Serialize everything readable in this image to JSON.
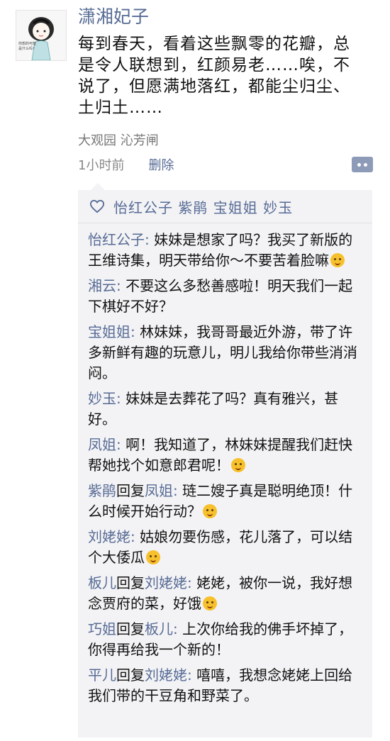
{
  "post": {
    "author": "潇湘妃子",
    "text": "每到春天，看着这些飘零的花瓣，总是令人联想到，红颜易老……唉，不说了，但愿满地落红，都能尘归尘、土归土……",
    "location": "大观园 沁芳闸",
    "time": "1小时前",
    "delete_label": "删除",
    "avatar_caption": "你想的可能是什么吗?"
  },
  "likes": {
    "names": "怡红公子 紫鹃 宝姐姐 妙玉"
  },
  "comments": [
    {
      "name": "怡红公子",
      "sep": ": ",
      "text": "妹妹是想家了吗？我买了新版的王维诗集，明天带给你～不要苦着脸嘛",
      "emoji": "kiss-emoji"
    },
    {
      "name": "湘云",
      "sep": ": ",
      "text": "不要这么多愁善感啦！明天我们一起下棋好不好？"
    },
    {
      "name": "宝姐姐",
      "sep": ": ",
      "text": "林妹妹，我哥哥最近外游，带了许多新鲜有趣的玩意儿，明儿我给你带些消消闷。"
    },
    {
      "name": "妙玉",
      "sep": ": ",
      "text": "妹妹是去葬花了吗？真有雅兴，甚好。"
    },
    {
      "name": "凤姐",
      "sep": ": ",
      "text": "啊！我知道了，林妹妹提醒我们赶快帮她找个如意郎君呢！",
      "emoji": "tongue-emoji"
    },
    {
      "name": "紫鹃",
      "reply_word": "回复",
      "reply_to": "凤姐",
      "sep": ": ",
      "text": "琏二嫂子真是聪明绝顶！什么时候开始行动？",
      "emoji": "monocle-emoji"
    },
    {
      "name": "刘姥姥",
      "sep": ": ",
      "text": "姑娘勿要伤感，花儿落了，可以结个大倭瓜",
      "emoji": "yum-emoji"
    },
    {
      "name": "板儿",
      "reply_word": "回复",
      "reply_to": "刘姥姥",
      "sep": ": ",
      "text": "姥姥，被你一说，我好想念贾府的菜，好饿",
      "emoji": "drool-emoji"
    },
    {
      "name": "巧姐",
      "reply_word": "回复",
      "reply_to": "板儿",
      "sep": ": ",
      "text": "上次你给我的佛手坏掉了，你得再给我一个新的！"
    },
    {
      "name": "平儿",
      "reply_word": "回复",
      "reply_to": "刘姥姥",
      "sep": ": ",
      "text": "嘻嘻，我想念姥姥上回给我们带的干豆角和野菜了。"
    }
  ]
}
